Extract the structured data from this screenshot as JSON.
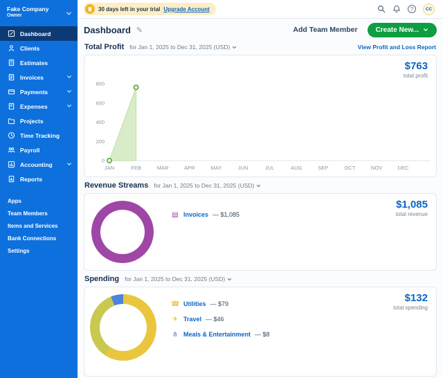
{
  "sidebar": {
    "company": {
      "name": "Fake Company",
      "role": "Owner"
    },
    "items": [
      {
        "label": "Dashboard",
        "icon": "dashboard-icon",
        "active": true
      },
      {
        "label": "Clients",
        "icon": "clients-icon"
      },
      {
        "label": "Estimates",
        "icon": "estimates-icon"
      },
      {
        "label": "Invoices",
        "icon": "invoices-icon",
        "expandable": true
      },
      {
        "label": "Payments",
        "icon": "payments-icon",
        "expandable": true
      },
      {
        "label": "Expenses",
        "icon": "expenses-icon",
        "expandable": true
      },
      {
        "label": "Projects",
        "icon": "projects-icon"
      },
      {
        "label": "Time Tracking",
        "icon": "time-tracking-icon"
      },
      {
        "label": "Payroll",
        "icon": "payroll-icon"
      },
      {
        "label": "Accounting",
        "icon": "accounting-icon",
        "expandable": true
      },
      {
        "label": "Reports",
        "icon": "reports-icon"
      }
    ],
    "secondary_items": [
      "Apps",
      "Team Members",
      "Items and Services",
      "Bank Connections",
      "Settings"
    ]
  },
  "topbar": {
    "trial_text": "30 days left in your trial",
    "trial_link": "Upgrade Account",
    "avatar": "CC"
  },
  "header": {
    "title": "Dashboard",
    "add_team_member": "Add Team Member",
    "create_new": "Create New..."
  },
  "profit": {
    "title": "Total Profit",
    "range": "for Jan 1, 2025 to Dec 31, 2025 (USD)",
    "link": "View Profit and Loss Report",
    "total": "$763",
    "total_label": "total profit"
  },
  "revenue": {
    "title": "Revenue Streams",
    "range": "for Jan 1, 2025 to Dec 31, 2025 (USD)",
    "total": "$1,085",
    "total_label": "total revenue"
  },
  "spending": {
    "title": "Spending",
    "range": "for Jan 1, 2025 to Dec 31, 2025 (USD)",
    "total": "$132",
    "total_label": "total spending"
  },
  "chart_data": [
    {
      "type": "area",
      "title": "Total Profit",
      "categories": [
        "JAN",
        "FEB",
        "MAR",
        "APR",
        "MAY",
        "JUN",
        "JUL",
        "AUG",
        "SEP",
        "OCT",
        "NOV",
        "DEC"
      ],
      "points": [
        {
          "month": "JAN",
          "value": 0
        },
        {
          "month": "FEB",
          "value": 763
        }
      ],
      "ylim": [
        0,
        800
      ],
      "yticks": [
        0,
        200,
        400,
        600,
        800
      ],
      "fill_color": "#d9ecca",
      "line_color": "#b9dda2",
      "point_color": "#56a23a",
      "point_fill": "#e4f2da"
    },
    {
      "type": "donut",
      "title": "Revenue Streams",
      "total": 1085,
      "slices": [
        {
          "label": "Invoices",
          "value": 1085,
          "display": "$1,085",
          "color": "#9e47a7",
          "icon": "invoice-icon"
        }
      ]
    },
    {
      "type": "donut",
      "title": "Spending",
      "total": 132,
      "slices": [
        {
          "label": "Utilities",
          "value": 79,
          "display": "$79",
          "color": "#e9c63d",
          "icon": "phone-icon"
        },
        {
          "label": "Travel",
          "value": 46,
          "display": "$46",
          "color": "#c9c850",
          "icon": "plane-icon"
        },
        {
          "label": "Meals & Entertainment",
          "value": 8,
          "display": "$8",
          "color": "#4d82de",
          "icon": "utensils-icon"
        }
      ]
    }
  ],
  "colors": {
    "sidebar": "#0d70dd",
    "sidebar_active": "#0c3a74",
    "accent_blue": "#0a66c4",
    "button_green": "#0e9d41"
  }
}
